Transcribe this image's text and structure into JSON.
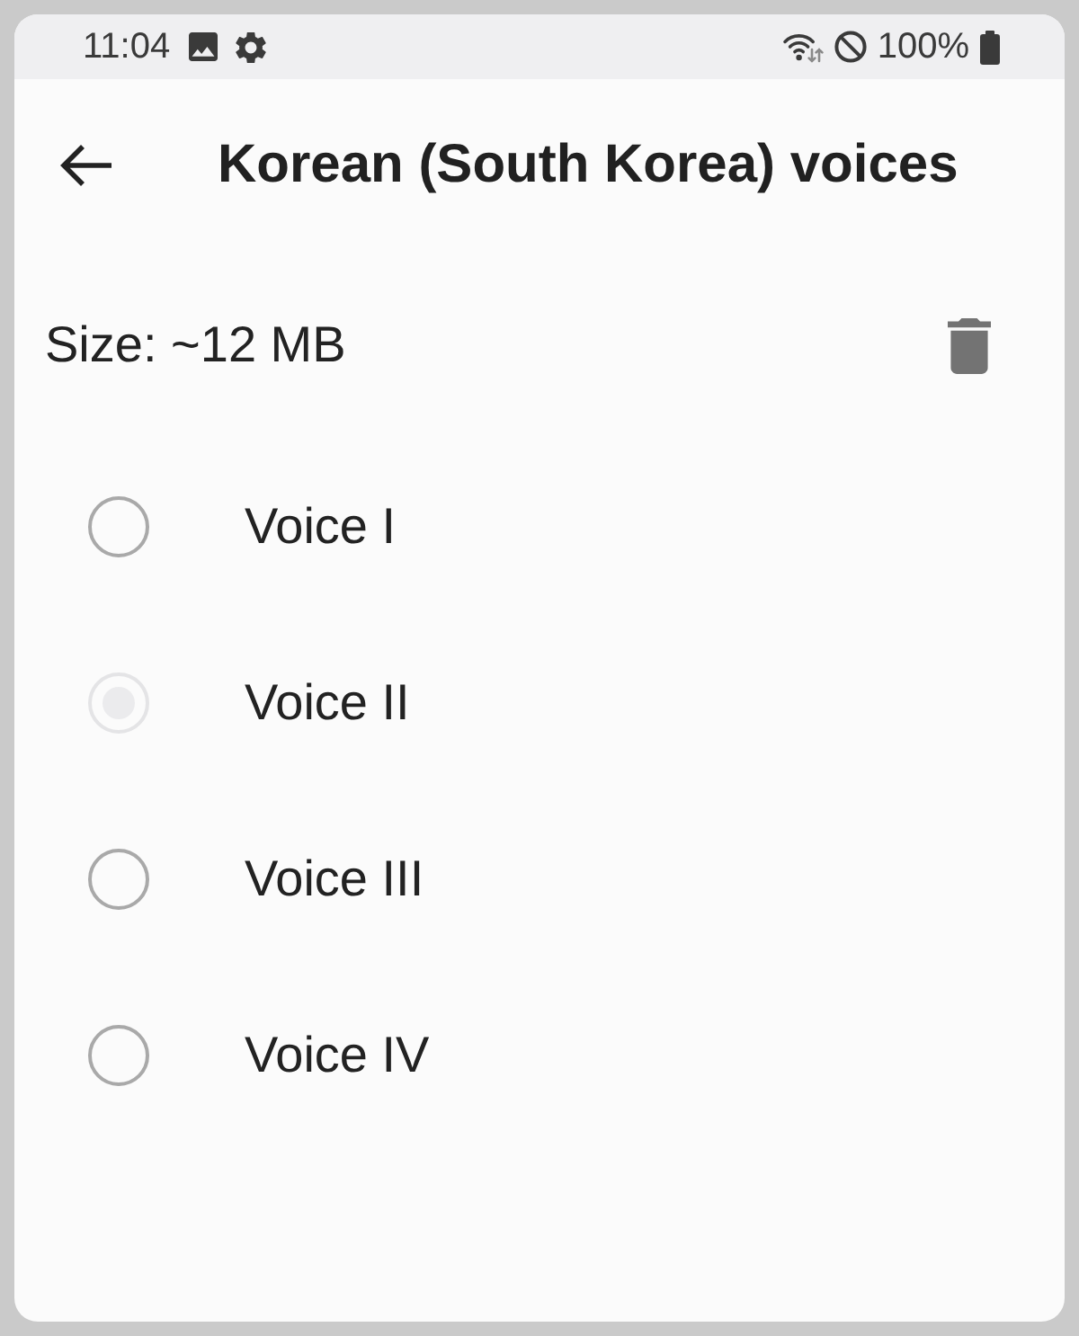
{
  "status_bar": {
    "time": "11:04",
    "battery_text": "100%"
  },
  "app_bar": {
    "title": "Korean (South Korea) voices"
  },
  "size": {
    "label": "Size: ~12 MB"
  },
  "voices": [
    {
      "label": "Voice I",
      "selected": false,
      "disabled": false
    },
    {
      "label": "Voice II",
      "selected": true,
      "disabled": true
    },
    {
      "label": "Voice III",
      "selected": false,
      "disabled": false
    },
    {
      "label": "Voice IV",
      "selected": false,
      "disabled": false
    }
  ]
}
